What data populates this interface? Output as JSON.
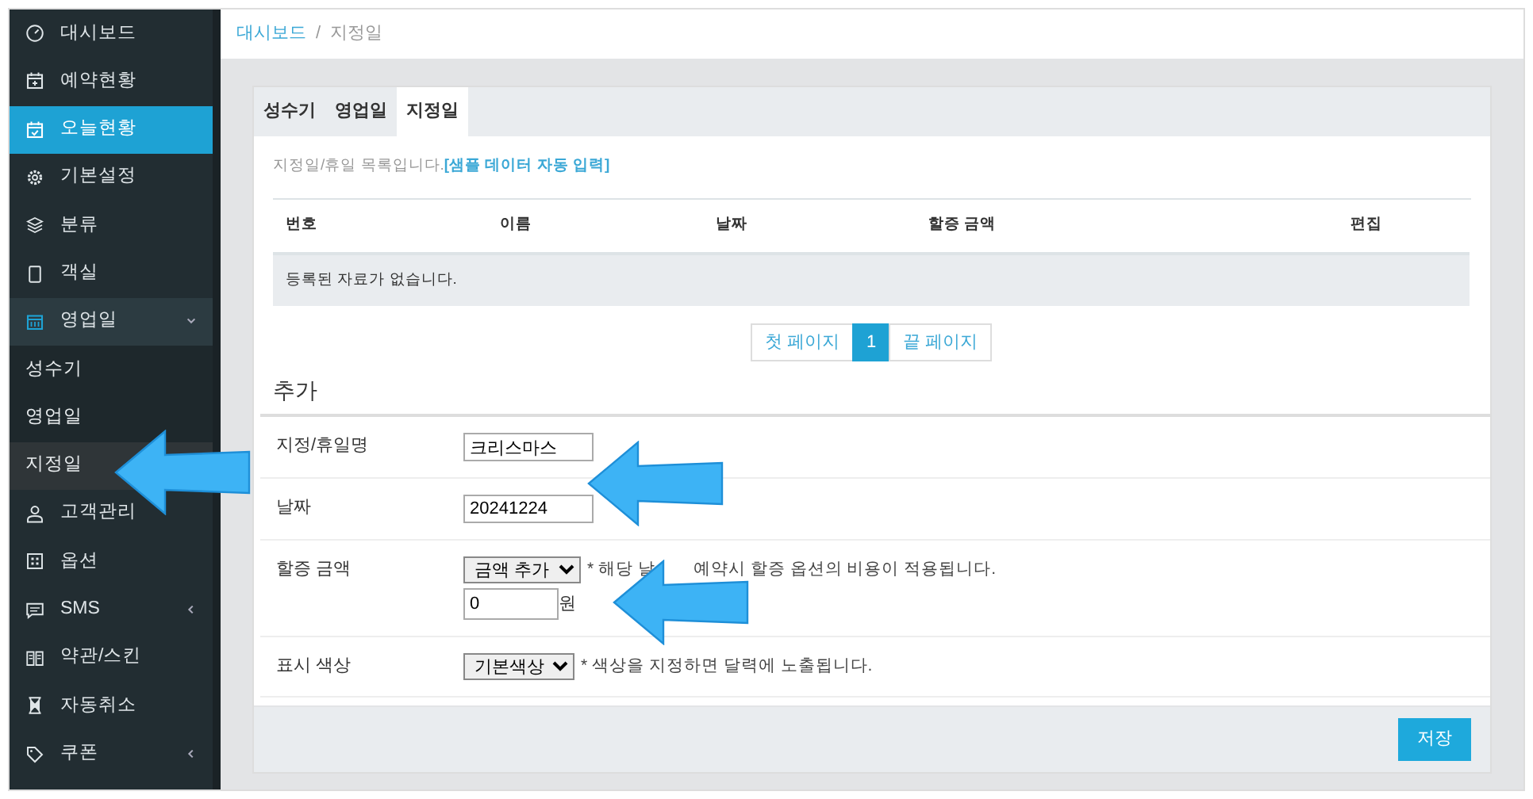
{
  "sidebar": {
    "items": [
      {
        "label": "대시보드",
        "kind": "item",
        "selected": false
      },
      {
        "label": "예약현황",
        "kind": "item",
        "selected": false
      },
      {
        "label": "오늘현황",
        "kind": "item",
        "selected": true
      },
      {
        "label": "기본설정",
        "kind": "item",
        "selected": false
      },
      {
        "label": "분류",
        "kind": "item",
        "selected": false
      },
      {
        "label": "객실",
        "kind": "item",
        "selected": false
      },
      {
        "label": "영업일",
        "kind": "group",
        "selected": false,
        "expanded": true,
        "children": [
          {
            "label": "성수기",
            "selected": false
          },
          {
            "label": "영업일",
            "selected": false
          },
          {
            "label": "지정일",
            "selected": true
          }
        ]
      },
      {
        "label": "고객관리",
        "kind": "item",
        "selected": false
      },
      {
        "label": "옵션",
        "kind": "item",
        "selected": false
      },
      {
        "label": "SMS",
        "kind": "group",
        "selected": false,
        "expanded": false
      },
      {
        "label": "약관/스킨",
        "kind": "item",
        "selected": false
      },
      {
        "label": "자동취소",
        "kind": "item",
        "selected": false
      },
      {
        "label": "쿠폰",
        "kind": "group",
        "selected": false,
        "expanded": false
      }
    ]
  },
  "breadcrumb": [
    {
      "label": "대시보드",
      "kind": "link"
    },
    {
      "label": "/",
      "kind": "separator"
    },
    {
      "label": "지정일",
      "kind": "current"
    }
  ],
  "tabs": [
    {
      "label": "성수기",
      "selected": false
    },
    {
      "label": "영업일",
      "selected": false
    },
    {
      "label": "지정일",
      "selected": true
    }
  ],
  "intro": {
    "text": "지정일/휴일 목록입니다.",
    "link": "[샘플 데이터 자동 입력]"
  },
  "table": {
    "columns": [
      "번호",
      "이름",
      "날짜",
      "할증 금액",
      "편집"
    ],
    "empty_message": "등록된 자료가 없습니다."
  },
  "pagination": [
    {
      "label": "첫 페이지",
      "selected": false
    },
    {
      "label": "1",
      "selected": true
    },
    {
      "label": "끝 페이지",
      "selected": false
    }
  ],
  "form": {
    "title": "추가",
    "rows": [
      {
        "label": "지정/휴일명",
        "kind": "text",
        "value": "크리스마스"
      },
      {
        "label": "날짜",
        "kind": "text",
        "value": "20241224"
      },
      {
        "label": "할증 금액",
        "kind": "surcharge",
        "select": "금액 추가",
        "hint": "* 해당 날",
        "hint_rest": "예약시 할증 옵션의 비용이 적용됩니다.",
        "value": "0",
        "unit": "원"
      },
      {
        "label": "표시 색상",
        "kind": "select",
        "select": "기본색상",
        "hint": "* 색상을 지정하면 달력에 노출됩니다."
      }
    ]
  },
  "save_button": "저장"
}
